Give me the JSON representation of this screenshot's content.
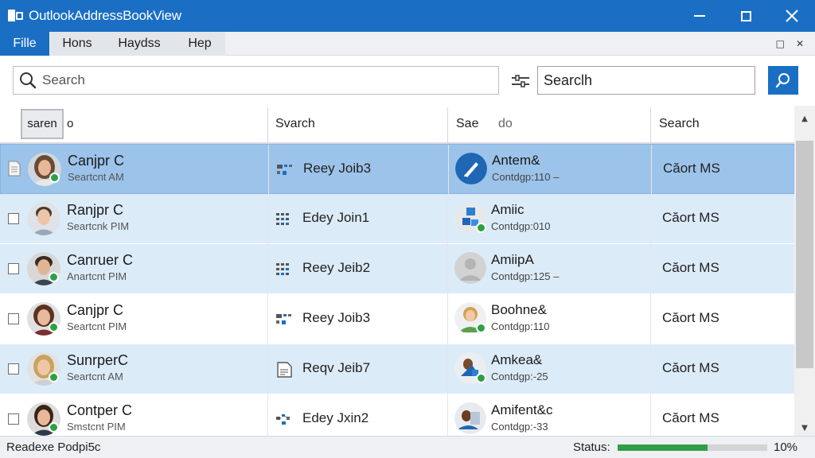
{
  "window": {
    "title": "OutlookAddressBookView"
  },
  "menu": {
    "items": [
      "Fille",
      "Hons",
      "Haydss",
      "Hep"
    ]
  },
  "toolbar": {
    "search_placeholder": "Search",
    "search2_value": "Searclh"
  },
  "columns": {
    "c1_button": "saren",
    "c1_sort": "o",
    "c2": "Svarch",
    "c3a": "Sae",
    "c3b": "do",
    "c4": "Search"
  },
  "rows": [
    {
      "name": "Canjpr C",
      "sub": "Seartcnt AM",
      "job": "Reey Joib3",
      "contact": "Antem&",
      "contact_sub": "Contdgp:110 –",
      "col4": "Căort MS",
      "style": "sel"
    },
    {
      "name": "Ranjpr C",
      "sub": "Seartcnk PIM",
      "job": "Edey Join1",
      "contact": "Amiic",
      "contact_sub": "Contdgp:010",
      "col4": "Căort MS",
      "style": "alt"
    },
    {
      "name": "Canruer C",
      "sub": "Anartcnt PIM",
      "job": "Reey Jeib2",
      "contact": "AmiipA",
      "contact_sub": "Contdgp:125 –",
      "col4": "Căort MS",
      "style": "alt"
    },
    {
      "name": "Canjpr C",
      "sub": "Seartcnt PIM",
      "job": "Reey Joib3",
      "contact": "Boohne&",
      "contact_sub": "Contdgp:110",
      "col4": "Căort MS",
      "style": "plain"
    },
    {
      "name": "SunrperC",
      "sub": "Seartcnt AM",
      "job": "Reqv Jeib7",
      "contact": "Amkea&",
      "contact_sub": "Contdgp:-25",
      "col4": "Căort MS",
      "style": "alt"
    },
    {
      "name": "Contper C",
      "sub": "Smstcnt PIM",
      "job": "Edey Jxin2",
      "contact": "Amifent&c",
      "contact_sub": "Contdgp:-33",
      "col4": "Căort MS",
      "style": "plain"
    }
  ],
  "status": {
    "left": "Readexe Podpi5c",
    "label": "Status:",
    "percent": "10%",
    "progress_fraction": 0.6
  },
  "colors": {
    "accent": "#1a6fc4",
    "selected_row": "#9cc3ea",
    "alt_row": "#dcebf8",
    "presence": "#2ea043"
  }
}
